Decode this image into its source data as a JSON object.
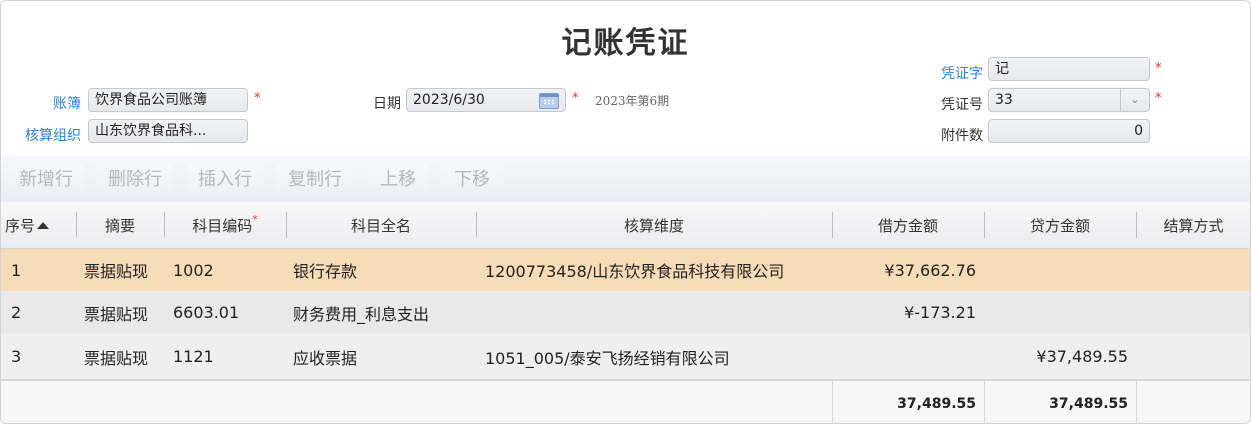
{
  "title": "记账凭证",
  "header": {
    "ledger_label": "账簿",
    "ledger_value": "饮界食品公司账簿",
    "org_label": "核算组织",
    "org_value": "山东饮界食品科...",
    "date_label": "日期",
    "date_value": "2023/6/30",
    "period_text": "2023年第6期",
    "voucher_word_label": "凭证字",
    "voucher_word_value": "记",
    "voucher_no_label": "凭证号",
    "voucher_no_value": "33",
    "attach_label": "附件数",
    "attach_value": "0",
    "required_mark": "*"
  },
  "toolbar": {
    "add_row": "新增行",
    "delete_row": "删除行",
    "insert_row": "插入行",
    "copy_row": "复制行",
    "move_up": "上移",
    "move_down": "下移"
  },
  "table": {
    "columns": {
      "seq": "序号",
      "summary": "摘要",
      "account_code": "科目编码",
      "account_name": "科目全名",
      "dimension": "核算维度",
      "debit": "借方金额",
      "credit": "贷方金额",
      "settlement": "结算方式"
    },
    "rows": [
      {
        "seq": "1",
        "summary": "票据贴现",
        "code": "1002",
        "name": "银行存款",
        "dimension": "1200773458/山东饮界食品科技有限公司",
        "debit": "¥37,662.76",
        "credit": "",
        "settlement": ""
      },
      {
        "seq": "2",
        "summary": "票据贴现",
        "code": "6603.01",
        "name": "财务费用_利息支出",
        "dimension": "",
        "debit": "¥-173.21",
        "credit": "",
        "settlement": ""
      },
      {
        "seq": "3",
        "summary": "票据贴现",
        "code": "1121",
        "name": "应收票据",
        "dimension": "1051_005/泰安飞扬经销有限公司",
        "debit": "",
        "credit": "¥37,489.55",
        "settlement": ""
      }
    ],
    "totals": {
      "debit": "37,489.55",
      "credit": "37,489.55"
    }
  },
  "colors": {
    "accent_link": "#2f7fdc",
    "selected_row": "#f7dcb7",
    "required": "#e0353b"
  }
}
